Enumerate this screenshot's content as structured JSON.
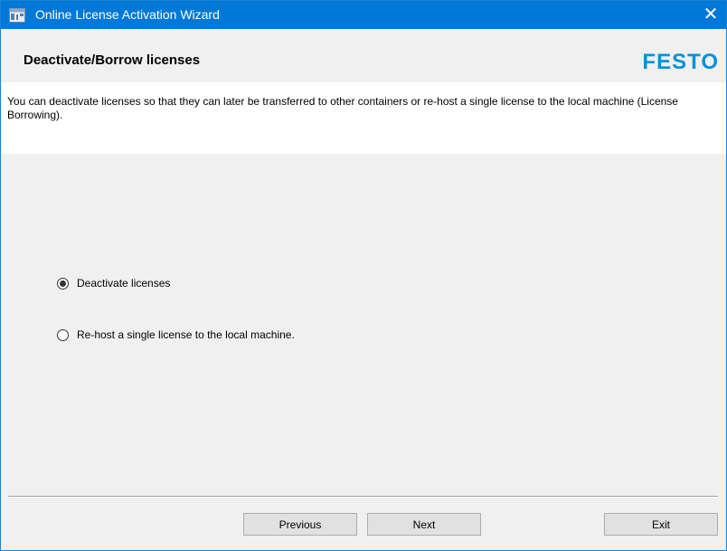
{
  "window": {
    "title": "Online License Activation Wizard",
    "close_glyph": "✕",
    "icon": "license-wizard-icon"
  },
  "header": {
    "title": "Deactivate/Borrow licenses",
    "logo_text": "FESTO",
    "logo_color": "#0091dc"
  },
  "description": "You can deactivate licenses so that they can later be transferred to other containers or re-host a single license to the local machine (License Borrowing).",
  "options": [
    {
      "label": "Deactivate licenses",
      "selected": true
    },
    {
      "label": "Re-host a single license to the local machine.",
      "selected": false
    }
  ],
  "buttons": {
    "previous": "Previous",
    "next": "Next",
    "exit": "Exit"
  },
  "colors": {
    "titlebar": "#0078d7",
    "background": "#f0f0f0"
  }
}
